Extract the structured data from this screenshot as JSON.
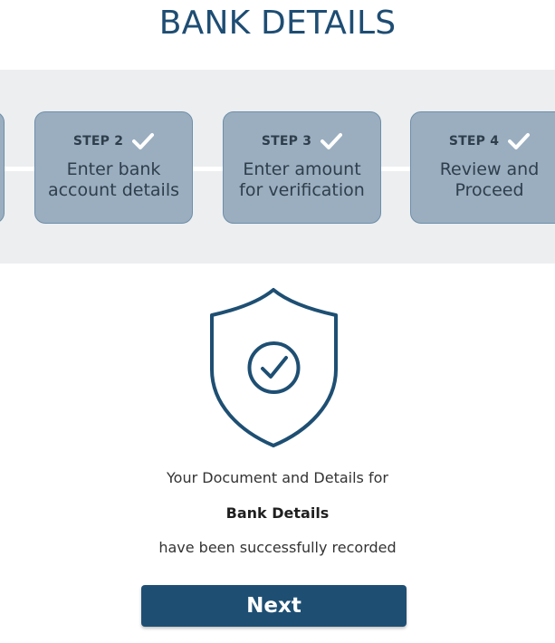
{
  "header": {
    "title": "BANK DETAILS"
  },
  "steps": [
    {
      "label": "STEP 2",
      "description_line1": "Enter bank",
      "description_line2": "account details",
      "status_icon": "check-icon"
    },
    {
      "label": "STEP 3",
      "description_line1": "Enter amount",
      "description_line2": "for verification",
      "status_icon": "check-icon"
    },
    {
      "label": "STEP 4",
      "description_line1": "Review and",
      "description_line2": "Proceed",
      "status_icon": "check-icon"
    }
  ],
  "success": {
    "icon": "shield-check-icon",
    "line1": "Your Document and Details for",
    "line2": "Bank Details",
    "line3": "have been successfully recorded"
  },
  "actions": {
    "next_label": "Next"
  },
  "colors": {
    "brand": "#1e4f73",
    "step_card_bg": "#9aaec0",
    "steps_band_bg": "#eceef0"
  }
}
